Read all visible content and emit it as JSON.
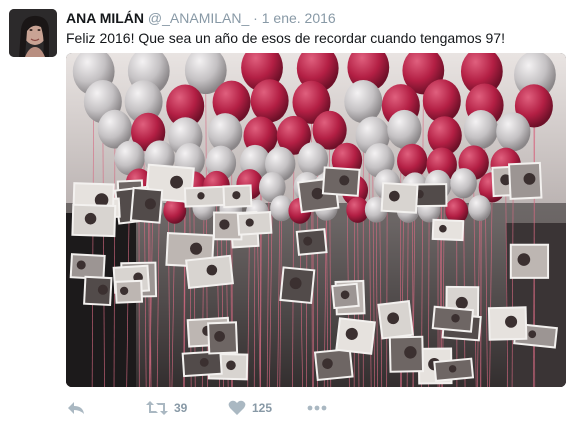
{
  "tweet": {
    "author_name": "ANA MILÁN",
    "handle": "@_ANAMILAN_",
    "separator": "·",
    "date": "1 ene. 2016",
    "text": "Feliz 2016! Que sea un año de esos de recordar cuando tengamos 97!"
  },
  "actions": {
    "retweet_count": "39",
    "like_count": "125"
  },
  "colors": {
    "balloon_red": "#b8264a",
    "balloon_silver": "#c9c6c8",
    "muted_icon": "#aab8c2"
  }
}
